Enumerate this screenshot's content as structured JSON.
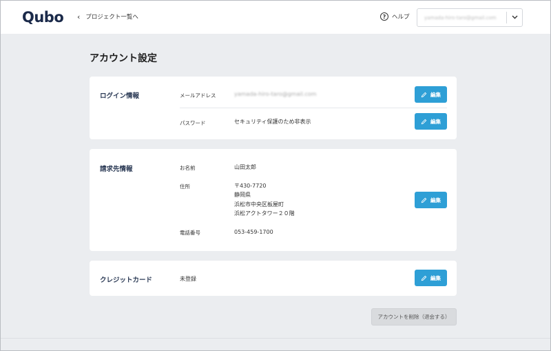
{
  "header": {
    "logo_text": "Qubo",
    "back_link": "プロジェクト一覧へ",
    "help_label": "ヘルプ",
    "account_email": "yamada-hiro-taro@gmail.com"
  },
  "page": {
    "title": "アカウント設定"
  },
  "login": {
    "title": "ログイン情報",
    "email_label": "メールアドレス",
    "email_value": "yamada-hiro-taro@gmail.com",
    "password_label": "パスワード",
    "password_value": "セキュリティ保護のため非表示",
    "edit_label": "編集"
  },
  "billing": {
    "title": "請求先情報",
    "name_label": "お名前",
    "name_value": "山田太郎",
    "address_label": "住所",
    "address_lines": [
      "〒430-7720",
      "静岡県",
      "浜松市中央区板屋町",
      "浜松アクトタワー２０階"
    ],
    "phone_label": "電話番号",
    "phone_value": "053-459-1700",
    "edit_label": "編集"
  },
  "credit": {
    "title": "クレジットカード",
    "status": "未登録",
    "edit_label": "編集"
  },
  "delete_button": "アカウントを削除（退会する）",
  "colors": {
    "accent": "#2e9fd6",
    "background": "#ebedf0",
    "card": "#ffffff"
  }
}
